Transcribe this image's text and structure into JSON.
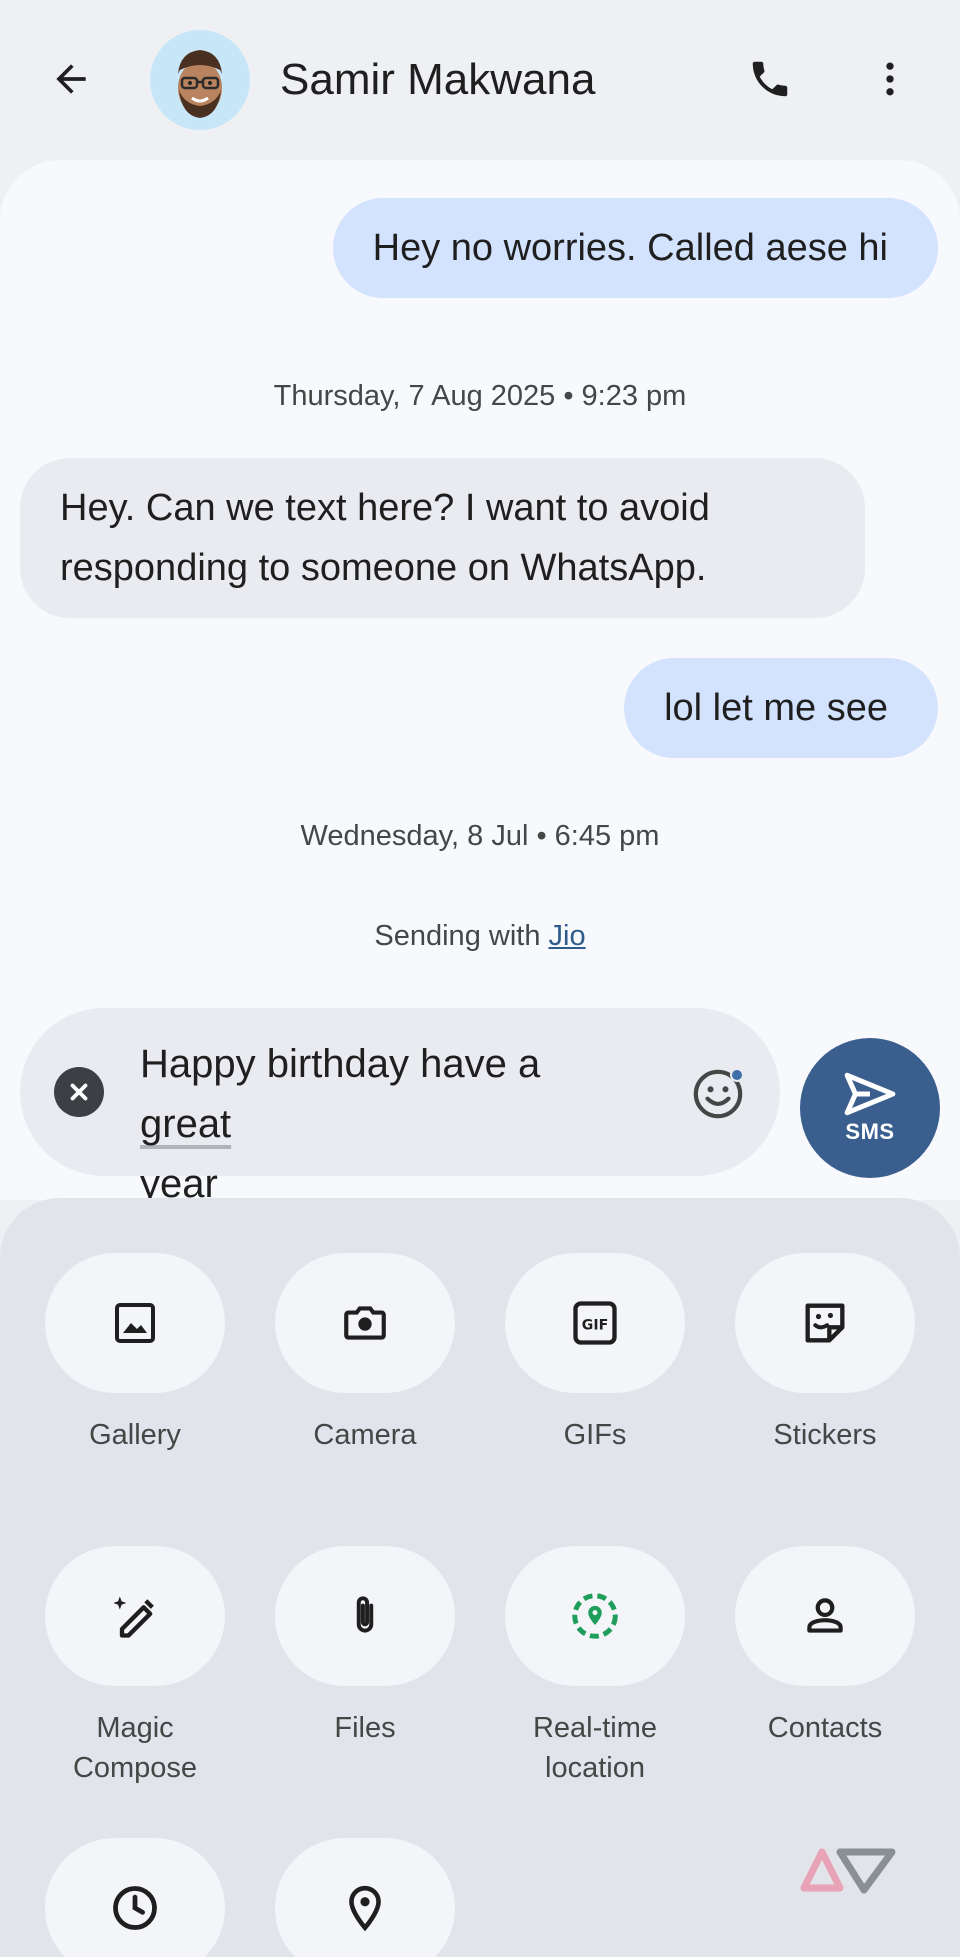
{
  "header": {
    "contact_name": "Samir Makwana",
    "back_icon": "arrow-back-icon",
    "call_icon": "phone-icon",
    "more_icon": "more-vert-icon"
  },
  "conversation": {
    "messages": [
      {
        "direction": "outgoing",
        "text": "Hey no worries. Called aese hi"
      },
      {
        "direction": "incoming",
        "text": "Hey. Can we text here? I want to avoid responding to someone on WhatsApp."
      },
      {
        "direction": "outgoing",
        "text": "lol let me see"
      }
    ],
    "timestamps": [
      "Thursday, 7 Aug 2025 • 9:23 pm",
      "Wednesday, 8 Jul • 6:45 pm"
    ],
    "sending_with_prefix": "Sending with ",
    "carrier": "Jio"
  },
  "compose": {
    "text_part1": "Happy birthday have a ",
    "text_word1": "great",
    "text_word2": "year",
    "send_label": "SMS"
  },
  "tray": {
    "items": [
      {
        "label": "Gallery",
        "icon": "gallery-icon"
      },
      {
        "label": "Camera",
        "icon": "camera-icon"
      },
      {
        "label": "GIFs",
        "icon": "gif-icon"
      },
      {
        "label": "Stickers",
        "icon": "sticker-icon"
      },
      {
        "label": "Magic Compose",
        "icon": "magic-compose-icon"
      },
      {
        "label": "Files",
        "icon": "attachment-icon"
      },
      {
        "label": "Real-time location",
        "icon": "live-location-icon"
      },
      {
        "label": "Contacts",
        "icon": "person-icon"
      },
      {
        "label": "",
        "icon": "schedule-icon"
      },
      {
        "label": "",
        "icon": "location-pin-icon"
      }
    ]
  },
  "colors": {
    "outgoing_bubble": "#d3e3fd",
    "incoming_bubble": "#e9ebf0",
    "send_button": "#3a5f8f",
    "live_location_green": "#1e9e5a"
  }
}
